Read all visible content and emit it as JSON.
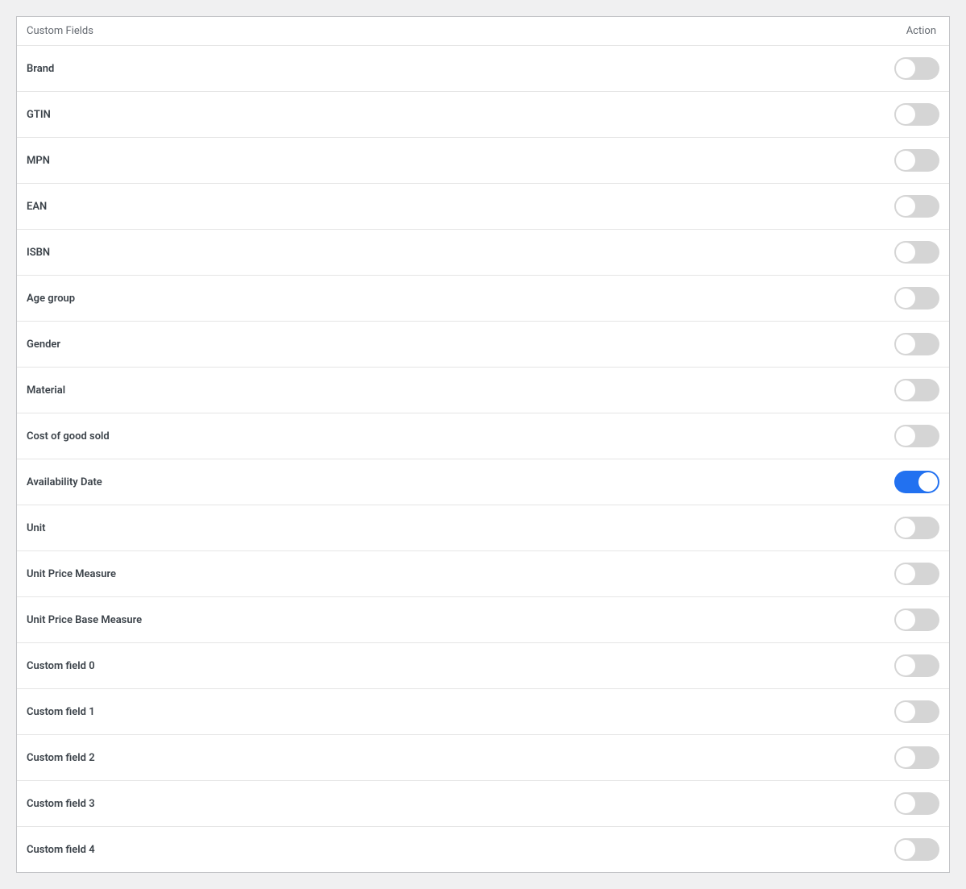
{
  "header": {
    "label": "Custom Fields",
    "action": "Action"
  },
  "rows": [
    {
      "label": "Brand",
      "on": false
    },
    {
      "label": "GTIN",
      "on": false
    },
    {
      "label": "MPN",
      "on": false
    },
    {
      "label": "EAN",
      "on": false
    },
    {
      "label": "ISBN",
      "on": false
    },
    {
      "label": "Age group",
      "on": false
    },
    {
      "label": "Gender",
      "on": false
    },
    {
      "label": "Material",
      "on": false
    },
    {
      "label": "Cost of good sold",
      "on": false
    },
    {
      "label": "Availability Date",
      "on": true
    },
    {
      "label": "Unit",
      "on": false
    },
    {
      "label": "Unit Price Measure",
      "on": false
    },
    {
      "label": "Unit Price Base Measure",
      "on": false
    },
    {
      "label": "Custom field 0",
      "on": false
    },
    {
      "label": "Custom field 1",
      "on": false
    },
    {
      "label": "Custom field 2",
      "on": false
    },
    {
      "label": "Custom field 3",
      "on": false
    },
    {
      "label": "Custom field 4",
      "on": false
    }
  ]
}
